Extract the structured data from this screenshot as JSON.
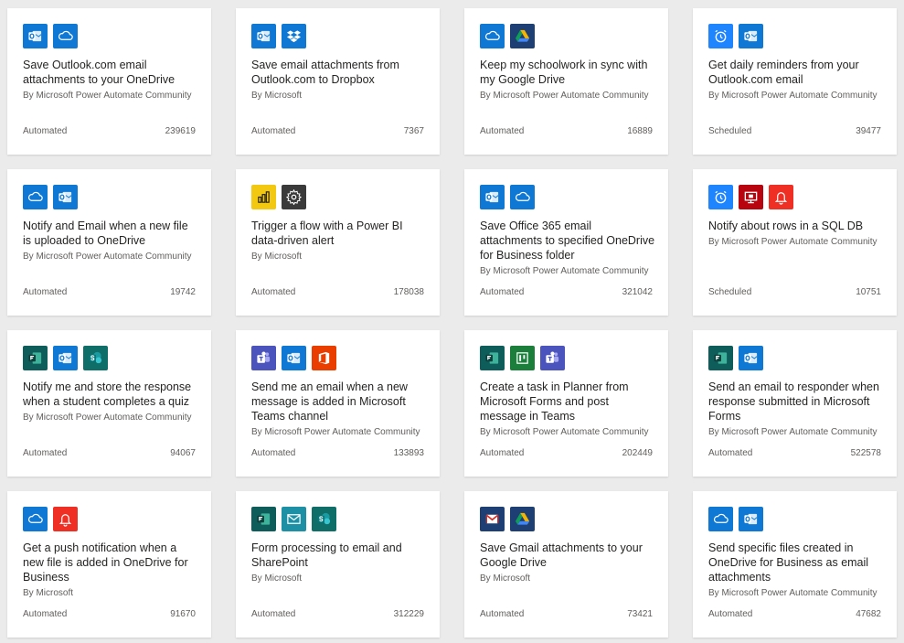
{
  "cards": [
    {
      "title": "Save Outlook.com email attachments to your OneDrive",
      "author": "By Microsoft Power Automate Community",
      "type": "Automated",
      "count": "239619",
      "icons": [
        "outlook",
        "onedrive"
      ]
    },
    {
      "title": "Save email attachments from Outlook.com to Dropbox",
      "author": "By Microsoft",
      "type": "Automated",
      "count": "7367",
      "icons": [
        "outlook",
        "dropbox"
      ]
    },
    {
      "title": "Keep my schoolwork in sync with my Google Drive",
      "author": "By Microsoft Power Automate Community",
      "type": "Automated",
      "count": "16889",
      "icons": [
        "onedrive",
        "google-drive"
      ]
    },
    {
      "title": "Get daily reminders from your Outlook.com email",
      "author": "By Microsoft Power Automate Community",
      "type": "Scheduled",
      "count": "39477",
      "icons": [
        "schedule",
        "outlook"
      ]
    },
    {
      "title": "Notify and Email when a new file is uploaded to OneDrive",
      "author": "By Microsoft Power Automate Community",
      "type": "Automated",
      "count": "19742",
      "icons": [
        "onedrive",
        "outlook"
      ]
    },
    {
      "title": "Trigger a flow with a Power BI data-driven alert",
      "author": "By Microsoft",
      "type": "Automated",
      "count": "178038",
      "icons": [
        "power-bi",
        "settings"
      ]
    },
    {
      "title": "Save Office 365 email attachments to specified OneDrive for Business folder",
      "author": "By Microsoft Power Automate Community",
      "type": "Automated",
      "count": "321042",
      "icons": [
        "outlook",
        "onedrive"
      ]
    },
    {
      "title": "Notify about rows in a SQL DB",
      "author": "By Microsoft Power Automate Community",
      "type": "Scheduled",
      "count": "10751",
      "icons": [
        "schedule",
        "sql",
        "notification"
      ]
    },
    {
      "title": "Notify me and store the response when a student completes a quiz",
      "author": "By Microsoft Power Automate Community",
      "type": "Automated",
      "count": "94067",
      "icons": [
        "forms",
        "outlook",
        "sharepoint"
      ]
    },
    {
      "title": "Send me an email when a new message is added in Microsoft Teams channel",
      "author": "By Microsoft Power Automate Community",
      "type": "Automated",
      "count": "133893",
      "icons": [
        "teams",
        "outlook",
        "office"
      ]
    },
    {
      "title": "Create a task in Planner from Microsoft Forms and post message in Teams",
      "author": "By Microsoft Power Automate Community",
      "type": "Automated",
      "count": "202449",
      "icons": [
        "forms",
        "planner",
        "teams"
      ]
    },
    {
      "title": "Send an email to responder when response submitted in Microsoft Forms",
      "author": "By Microsoft Power Automate Community",
      "type": "Automated",
      "count": "522578",
      "icons": [
        "forms",
        "outlook"
      ]
    },
    {
      "title": "Get a push notification when a new file is added in OneDrive for Business",
      "author": "By Microsoft",
      "type": "Automated",
      "count": "91670",
      "icons": [
        "onedrive",
        "notification"
      ]
    },
    {
      "title": "Form processing to email and SharePoint",
      "author": "By Microsoft",
      "type": "Automated",
      "count": "312229",
      "icons": [
        "forms",
        "mail",
        "sharepoint"
      ]
    },
    {
      "title": "Save Gmail attachments to your Google Drive",
      "author": "By Microsoft",
      "type": "Automated",
      "count": "73421",
      "icons": [
        "gmail",
        "google-drive"
      ]
    },
    {
      "title": "Send specific files created in OneDrive for Business as email attachments",
      "author": "By Microsoft Power Automate Community",
      "type": "Automated",
      "count": "47682",
      "icons": [
        "onedrive",
        "outlook"
      ]
    }
  ],
  "icon_colors": {
    "outlook": "#0f78d4",
    "onedrive": "#0f78d4",
    "dropbox": "#0f78d4",
    "google-drive": "#1d3f73",
    "schedule": "#1f85ff",
    "power-bi": "#f2c811",
    "settings": "#3a3a3a",
    "sql": "#b8040f",
    "notification": "#ef2f24",
    "forms": "#0f5d5a",
    "sharepoint": "#0f6e68",
    "teams": "#4b53bc",
    "office": "#ea3e00",
    "planner": "#1b7f3b",
    "mail": "#1e90a6",
    "gmail": "#1d3f73"
  }
}
